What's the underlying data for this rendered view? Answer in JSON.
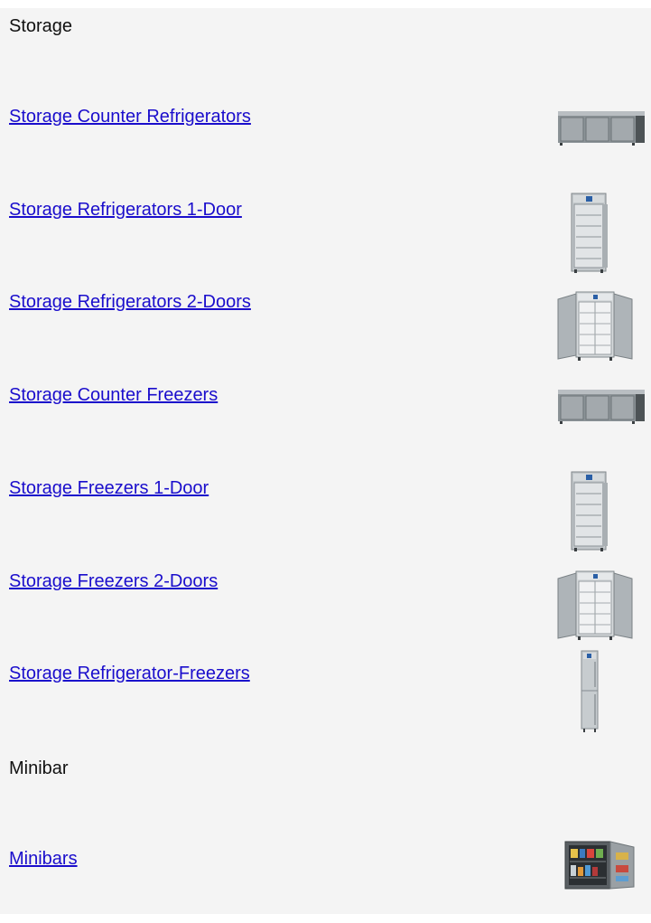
{
  "sections": [
    {
      "heading": "Storage",
      "items": [
        {
          "label": "Storage Counter Refrigerators",
          "icon": "counter-refrigerator-icon"
        },
        {
          "label": "Storage Refrigerators 1-Door",
          "icon": "refrigerator-1-door-icon"
        },
        {
          "label": "Storage Refrigerators 2-Doors",
          "icon": "refrigerator-2-doors-icon"
        },
        {
          "label": "Storage Counter Freezers",
          "icon": "counter-freezer-icon"
        },
        {
          "label": "Storage Freezers 1-Door",
          "icon": "freezer-1-door-icon"
        },
        {
          "label": "Storage Freezers 2-Doors",
          "icon": "freezer-2-doors-icon"
        },
        {
          "label": "Storage Refrigerator-Freezers",
          "icon": "refrigerator-freezer-icon"
        }
      ]
    },
    {
      "heading": "Minibar",
      "items": [
        {
          "label": "Minibars",
          "icon": "minibar-icon"
        }
      ]
    }
  ],
  "colors": {
    "background": "#f4f4f4",
    "link": "#1a0dcc",
    "steel": "#9aa0a4"
  }
}
